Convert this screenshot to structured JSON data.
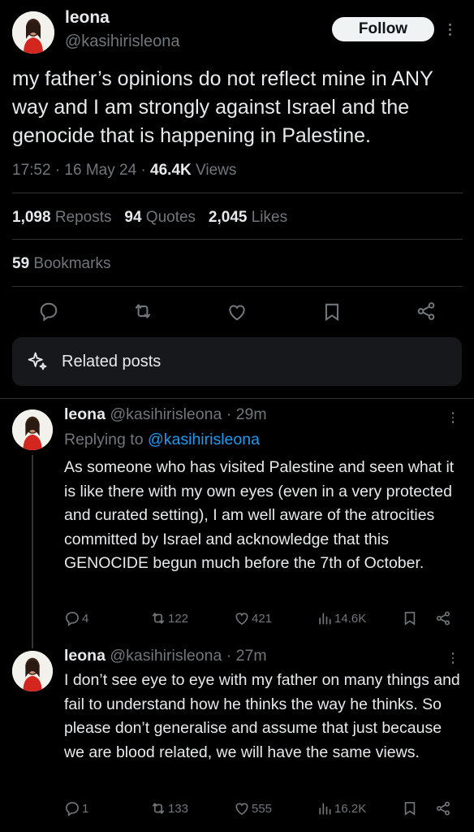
{
  "main_tweet": {
    "name": "leona",
    "handle": "@kasihirisleona",
    "follow_label": "Follow",
    "text": "my father’s opinions do not reflect mine in ANY way and I am strongly against Israel and the genocide that is happening in Palestine.",
    "time": "17:52 · 16 May 24 · ",
    "views_count": "46.4K",
    "views_label": " Views",
    "reposts_count": "1,098",
    "reposts_label": " Reposts",
    "quotes_count": "94",
    "quotes_label": " Quotes",
    "likes_count": "2,045",
    "likes_label": " Likes",
    "bookmarks_count": "59",
    "bookmarks_label": " Bookmarks"
  },
  "related": {
    "label": "Related posts"
  },
  "replies": [
    {
      "name": "leona",
      "handle_time": "@kasihirisleona · 29m",
      "replying_prefix": "Replying to ",
      "replying_handle": "@kasihirisleona",
      "text": "As someone who has visited Palestine and seen what it is like there with my own eyes (even in a very protected and curated setting), I am well aware of the atrocities committed by Israel and acknowledge that this GENOCIDE begun much before the 7th of October.",
      "replies": "4",
      "reposts": "122",
      "likes": "421",
      "views": "14.6K"
    },
    {
      "name": "leona",
      "handle_time": "@kasihirisleona · 27m",
      "text": "I don’t see eye to eye with my father on many things and fail to understand how he thinks the way he thinks. So please don’t generalise and assume that just because we are blood related, we will have the same views.",
      "replies": "1",
      "reposts": "133",
      "likes": "555",
      "views": "16.2K"
    }
  ],
  "colors": {
    "background": "#000000",
    "text": "#e7e9ea",
    "muted": "#71767b",
    "link": "#1d9bf0"
  },
  "icons": [
    "reply-icon",
    "repost-icon",
    "like-icon",
    "bookmark-icon",
    "share-icon",
    "views-icon",
    "sparkle-icon",
    "more-icon"
  ]
}
